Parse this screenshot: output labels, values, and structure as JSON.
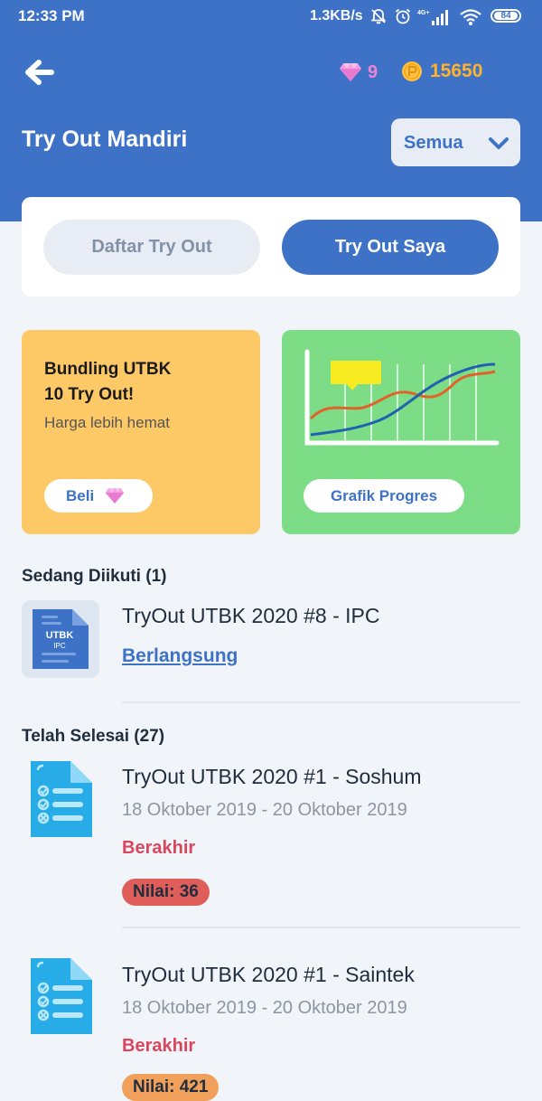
{
  "status_bar": {
    "time": "12:33 PM",
    "speed": "1.3KB/s",
    "network": "4G+",
    "battery": "84"
  },
  "header": {
    "gems": "9",
    "coins": "15650",
    "title": "Try Out Mandiri",
    "filter_label": "Semua"
  },
  "tabs": {
    "list_label": "Daftar Try Out",
    "mine_label": "Try Out Saya",
    "active": "Try Out Saya"
  },
  "promo": {
    "bundle_title": "Bundling UTBK\n10 Try Out!",
    "bundle_sub": "Harga lebih hemat",
    "buy_label": "Beli",
    "progress_label": "Grafik Progres"
  },
  "in_progress": {
    "section_title": "Sedang Diikuti (1)",
    "item": {
      "icon_title": "UTBK",
      "icon_sub": "IPC",
      "title": "TryOut UTBK 2020 #8 - IPC",
      "status": "Berlangsung"
    }
  },
  "completed": {
    "section_title": "Telah Selesai (27)",
    "items": [
      {
        "title": "TryOut UTBK 2020 #1 - Soshum",
        "date": "18 Oktober 2019 - 20 Oktober 2019",
        "status": "Berakhir",
        "score": "Nilai: 36"
      },
      {
        "title": "TryOut UTBK 2020 #1 - Saintek",
        "date": "18 Oktober 2019 - 20 Oktober 2019",
        "status": "Berakhir",
        "score": "Nilai: 421"
      }
    ]
  },
  "colors": {
    "primary": "#3d72c7",
    "header_bg": "#3d72c7",
    "promo_yellow": "#fdc866",
    "promo_green": "#7ddc86",
    "status_ended": "#d8475e",
    "score_red": "#e05e5a",
    "score_orange": "#f0a05a"
  }
}
